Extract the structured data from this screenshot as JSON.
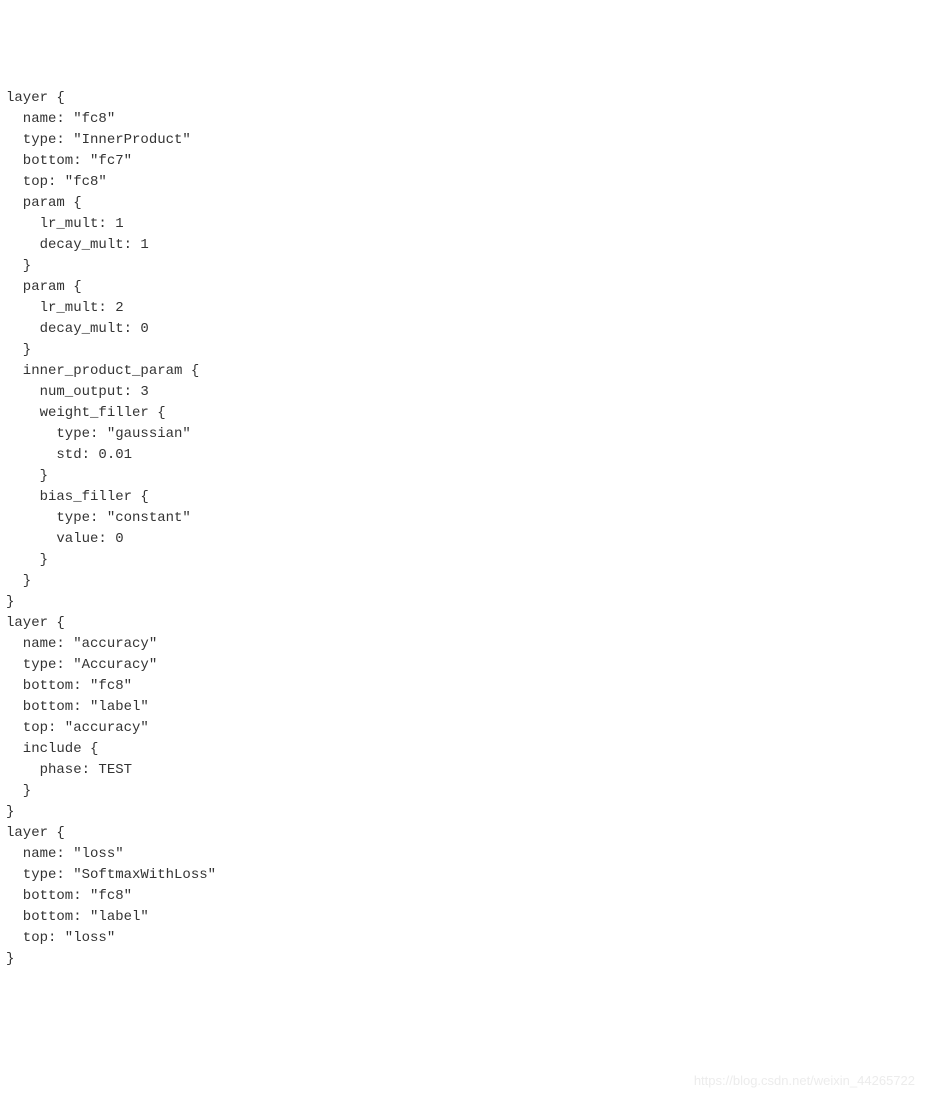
{
  "code_lines": [
    "layer {",
    "  name: \"fc8\"",
    "  type: \"InnerProduct\"",
    "  bottom: \"fc7\"",
    "  top: \"fc8\"",
    "  param {",
    "    lr_mult: 1",
    "    decay_mult: 1",
    "  }",
    "  param {",
    "    lr_mult: 2",
    "    decay_mult: 0",
    "  }",
    "  inner_product_param {",
    "    num_output: 3",
    "    weight_filler {",
    "      type: \"gaussian\"",
    "      std: 0.01",
    "    }",
    "    bias_filler {",
    "      type: \"constant\"",
    "      value: 0",
    "    }",
    "  }",
    "}",
    "layer {",
    "  name: \"accuracy\"",
    "  type: \"Accuracy\"",
    "  bottom: \"fc8\"",
    "  bottom: \"label\"",
    "  top: \"accuracy\"",
    "  include {",
    "    phase: TEST",
    "  }",
    "}",
    "layer {",
    "  name: \"loss\"",
    "  type: \"SoftmaxWithLoss\"",
    "  bottom: \"fc8\"",
    "  bottom: \"label\"",
    "  top: \"loss\"",
    "}"
  ],
  "watermark": "https://blog.csdn.net/weixin_44265722"
}
